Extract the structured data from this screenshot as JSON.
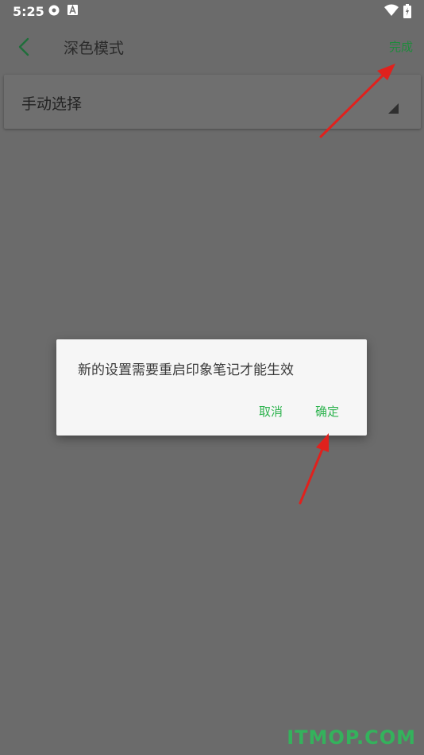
{
  "status_bar": {
    "time": "5:25",
    "icons": [
      "settings-gear-icon",
      "text-a-icon",
      "wifi-icon",
      "battery-charging-icon"
    ]
  },
  "top_bar": {
    "back_icon": "chevron-left-icon",
    "title": "深色模式",
    "done_label": "完成",
    "accent_color": "#1f8a3c"
  },
  "mode_select": {
    "value": "手动选择",
    "arrow_icon": "dropdown-triangle-icon"
  },
  "dialog": {
    "message": "新的设置需要重启印象笔记才能生效",
    "cancel_label": "取消",
    "confirm_label": "确定",
    "button_color": "#2db34e"
  },
  "annotations": {
    "arrow_color": "#e0211d"
  },
  "watermark": {
    "text": "ITMOP.COM"
  }
}
